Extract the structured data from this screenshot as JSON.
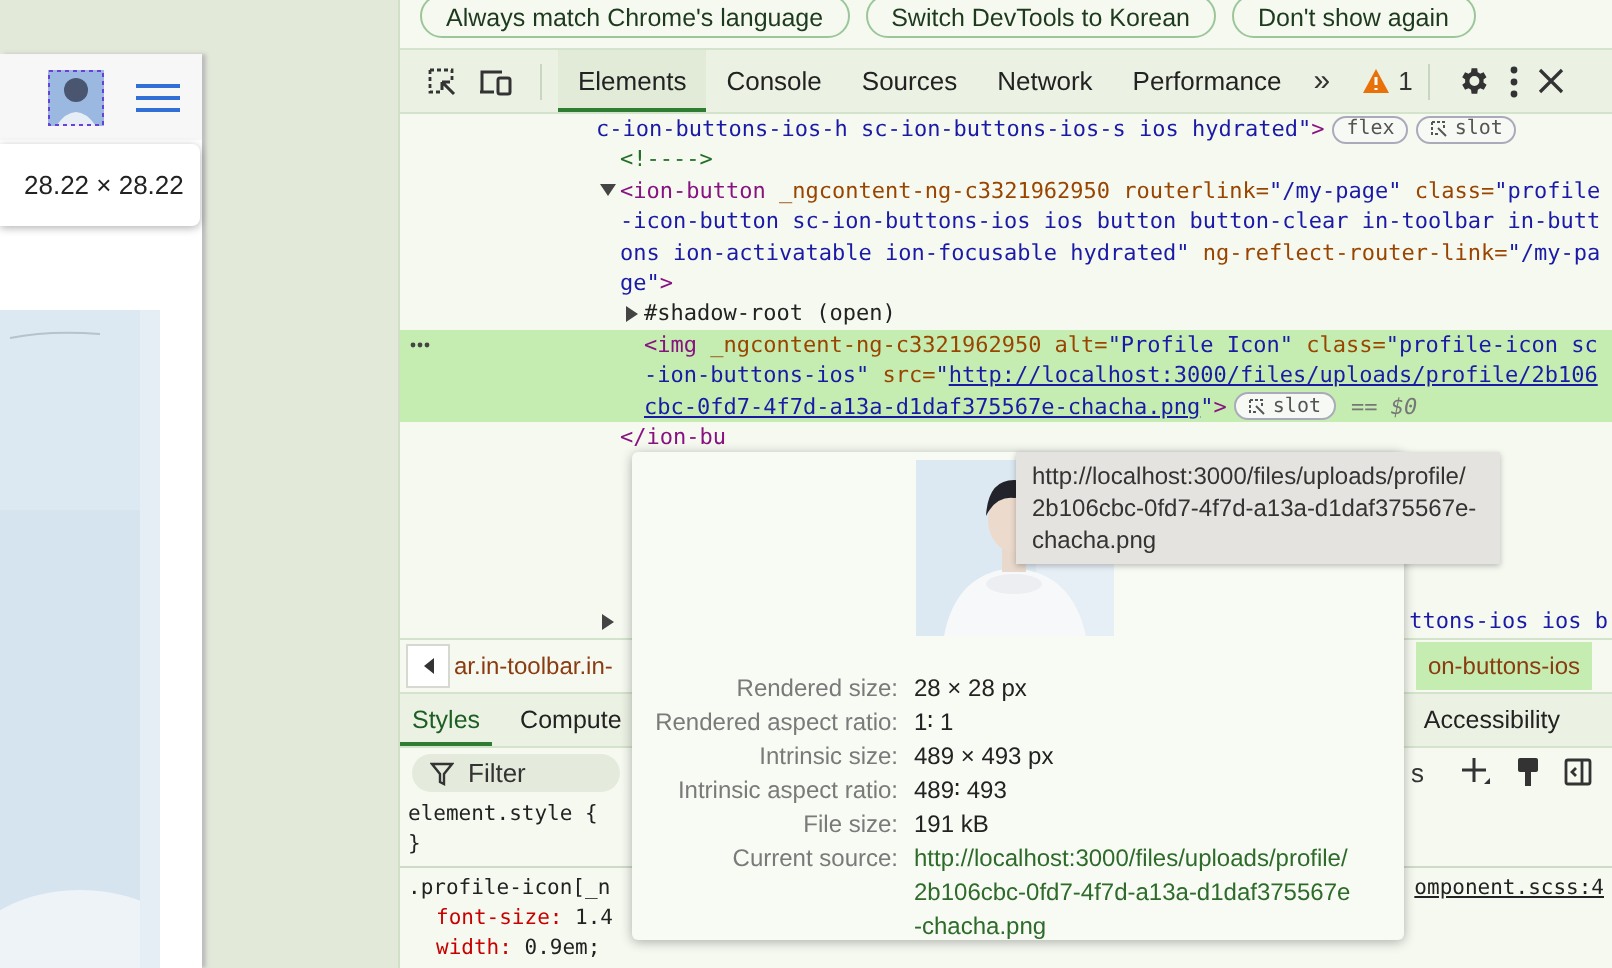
{
  "page": {
    "dimension_tooltip": "28.22 × 28.22"
  },
  "banner_buttons": [
    "Always match Chrome's language",
    "Switch DevTools to Korean",
    "Don't show again"
  ],
  "toolbar": {
    "tabs": [
      {
        "label": "Elements",
        "selected": true
      },
      {
        "label": "Console",
        "selected": false
      },
      {
        "label": "Sources",
        "selected": false
      },
      {
        "label": "Network",
        "selected": false
      },
      {
        "label": "Performance",
        "selected": false
      }
    ],
    "overflow": "»",
    "warning_count": "1"
  },
  "elements": {
    "nodes": [
      {
        "lines": [
          [
            {
              "kind": "value",
              "s": "c-ion-buttons-ios-h sc-ion-buttons-ios-s ios hydrated\""
            },
            {
              "kind": "tag",
              "s": ">"
            }
          ]
        ],
        "badges": [
          {
            "label": "flex",
            "kind": "plain"
          },
          {
            "label": "slot",
            "kind": "slot"
          }
        ],
        "children": [
          {
            "lines": [
              [
                {
                  "kind": "comment",
                  "s": "<!---->"
                }
              ]
            ]
          },
          {
            "expanded": true,
            "lines": [
              [
                {
                  "kind": "tag",
                  "s": "<ion-button "
                },
                {
                  "kind": "attr",
                  "s": "_ngcontent-ng-c3321962950 routerlink="
                },
                {
                  "kind": "value",
                  "s": "\"/my-page\""
                },
                {
                  "kind": "attr",
                  "s": " class="
                },
                {
                  "kind": "value",
                  "s": "\"profile"
                }
              ],
              [
                {
                  "kind": "value",
                  "s": "-icon-button sc-ion-buttons-ios ios button button-clear in-toolbar in-butt"
                }
              ],
              [
                {
                  "kind": "value",
                  "s": "ons ion-activatable ion-focusable hydrated\""
                },
                {
                  "kind": "attr",
                  "s": " ng-reflect-router-link="
                },
                {
                  "kind": "value",
                  "s": "\"/my-pa"
                }
              ],
              [
                {
                  "kind": "value",
                  "s": "ge\""
                },
                {
                  "kind": "tag",
                  "s": ">"
                }
              ]
            ],
            "close": "</ion-bu",
            "children": [
              {
                "expanded": false,
                "lines": [
                  [
                    {
                      "kind": "plain",
                      "s": "#shadow-root (open)"
                    }
                  ]
                ]
              },
              {
                "selected": true,
                "lines": [
                  [
                    {
                      "kind": "tag",
                      "s": "<img "
                    },
                    {
                      "kind": "attr",
                      "s": "_ngcontent-ng-c3321962950 alt="
                    },
                    {
                      "kind": "value",
                      "s": "\"Profile Icon\""
                    },
                    {
                      "kind": "attr",
                      "s": " class="
                    },
                    {
                      "kind": "value",
                      "s": "\"profile-icon sc"
                    }
                  ],
                  [
                    {
                      "kind": "value",
                      "s": "-ion-buttons-ios\""
                    },
                    {
                      "kind": "attr",
                      "s": " src="
                    },
                    {
                      "kind": "value",
                      "s": "\""
                    },
                    {
                      "kind": "link",
                      "s": "http://localhost:3000/files/uploads/profile/2b106"
                    }
                  ],
                  [
                    {
                      "kind": "link",
                      "s": "cbc-0fd7-4f7d-a13a-d1daf375567e-chacha.png"
                    },
                    {
                      "kind": "value",
                      "s": "\""
                    },
                    {
                      "kind": "tag",
                      "s": ">"
                    }
                  ]
                ],
                "badges": [
                  {
                    "label": "slot",
                    "kind": "slot"
                  }
                ],
                "suffix": "== $0"
              }
            ]
          },
          {
            "kind": "covered",
            "expanded": false,
            "lines": [
              [
                {
                  "kind": "value",
                  "s": "ttons-ios ios b"
                }
              ]
            ]
          }
        ]
      }
    ]
  },
  "breadcrumb": {
    "left": "ar.in-toolbar.in-",
    "right": "on-buttons-ios"
  },
  "sidebar_tabs": [
    {
      "label": "Styles",
      "selected": true
    },
    {
      "label": "Compute",
      "selected": false
    },
    {
      "label": "Accessibility",
      "selected": false
    }
  ],
  "filter": {
    "placeholder": "Filter",
    "cut_text": "s"
  },
  "styles": {
    "element_style_open": "element.style {",
    "element_style_close": "}",
    "rule_selector": ".profile-icon[_n",
    "rule_source": "omponent.scss:4",
    "declarations": [
      {
        "prop": "font-size:",
        "value": "1.4"
      },
      {
        "prop": "width:",
        "value": "0.9em;"
      }
    ]
  },
  "image_popover": {
    "rows": [
      {
        "label": "Rendered size:",
        "value": [
          "28 × 28 px"
        ]
      },
      {
        "label": "Rendered aspect ratio:",
        "value": [
          "1∶ 1"
        ]
      },
      {
        "label": "Intrinsic size:",
        "value": [
          "489 × 493 px"
        ]
      },
      {
        "label": "Intrinsic aspect ratio:",
        "value": [
          "489∶ 493"
        ]
      },
      {
        "label": "File size:",
        "value": [
          "191 kB"
        ]
      },
      {
        "label": "Current source:",
        "value": [
          "http://localhost:3000/files/uploads/profile/",
          "2b106cbc-0fd7-4f7d-a13a-d1daf375567e",
          "-chacha.png"
        ],
        "kind": "link"
      }
    ]
  },
  "url_tooltip": [
    "http://localhost:3000/files/uploads/profile/",
    "2b106cbc-0fd7-4f7d-a13a-d1daf375567e-",
    "chacha.png"
  ]
}
